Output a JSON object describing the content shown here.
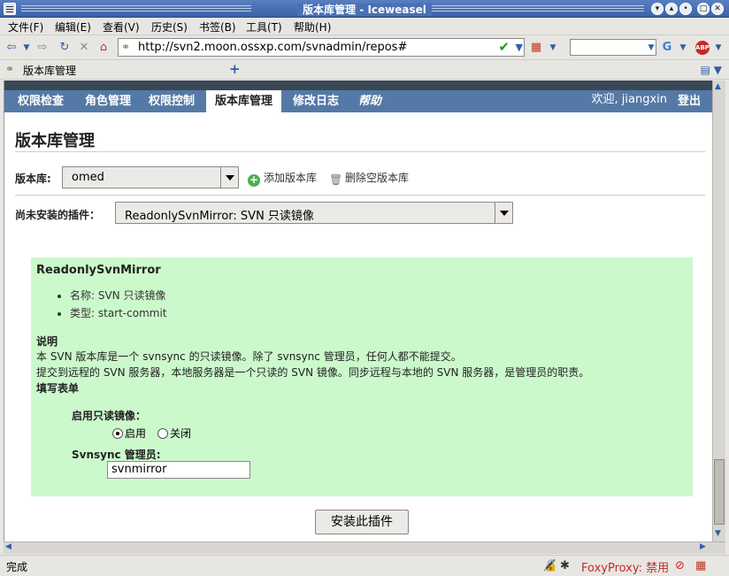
{
  "window": {
    "title": "版本库管理 - Iceweasel"
  },
  "menu": [
    "文件(F)",
    "编辑(E)",
    "查看(V)",
    "历史(S)",
    "书签(B)",
    "工具(T)",
    "帮助(H)"
  ],
  "browser": {
    "url": "http://svn2.moon.ossxp.com/svnadmin/repos#",
    "tab_label": "版本库管理",
    "status": "完成",
    "foxyproxy": "FoxyProxy: 禁用"
  },
  "app_nav": {
    "items": [
      "权限检查",
      "角色管理",
      "权限控制",
      "版本库管理",
      "修改日志",
      "帮助"
    ],
    "active_index": 3,
    "welcome": "欢迎, jiangxin",
    "logout": "登出"
  },
  "page": {
    "title": "版本库管理",
    "repo_label": "版本库:",
    "repo_value": "omed",
    "add_repo": "添加版本库",
    "delete_empty_repo": "删除空版本库",
    "plugin_label": "尚未安装的插件：",
    "plugin_value": "ReadonlySvnMirror: SVN 只读镜像"
  },
  "plugin": {
    "name": "ReadonlySvnMirror",
    "details": [
      "名称: SVN 只读镜像",
      "类型: start-commit"
    ],
    "desc_heading": "说明",
    "desc_line1": "本 SVN 版本库是一个 svnsync 的只读镜像。除了 svnsync 管理员，任何人都不能提交。",
    "desc_line2": "提交到远程的 SVN 服务器，本地服务器是一个只读的 SVN 镜像。同步远程与本地的 SVN 服务器，是管理员的职责。",
    "form_heading": "填写表单",
    "enable_label": "启用只读镜像：",
    "radio_on": "启用",
    "radio_off": "关闭",
    "radio_selected": "启用",
    "admin_label": "Svnsync 管理员:",
    "admin_value": "svnmirror",
    "install_button": "安装此插件"
  }
}
